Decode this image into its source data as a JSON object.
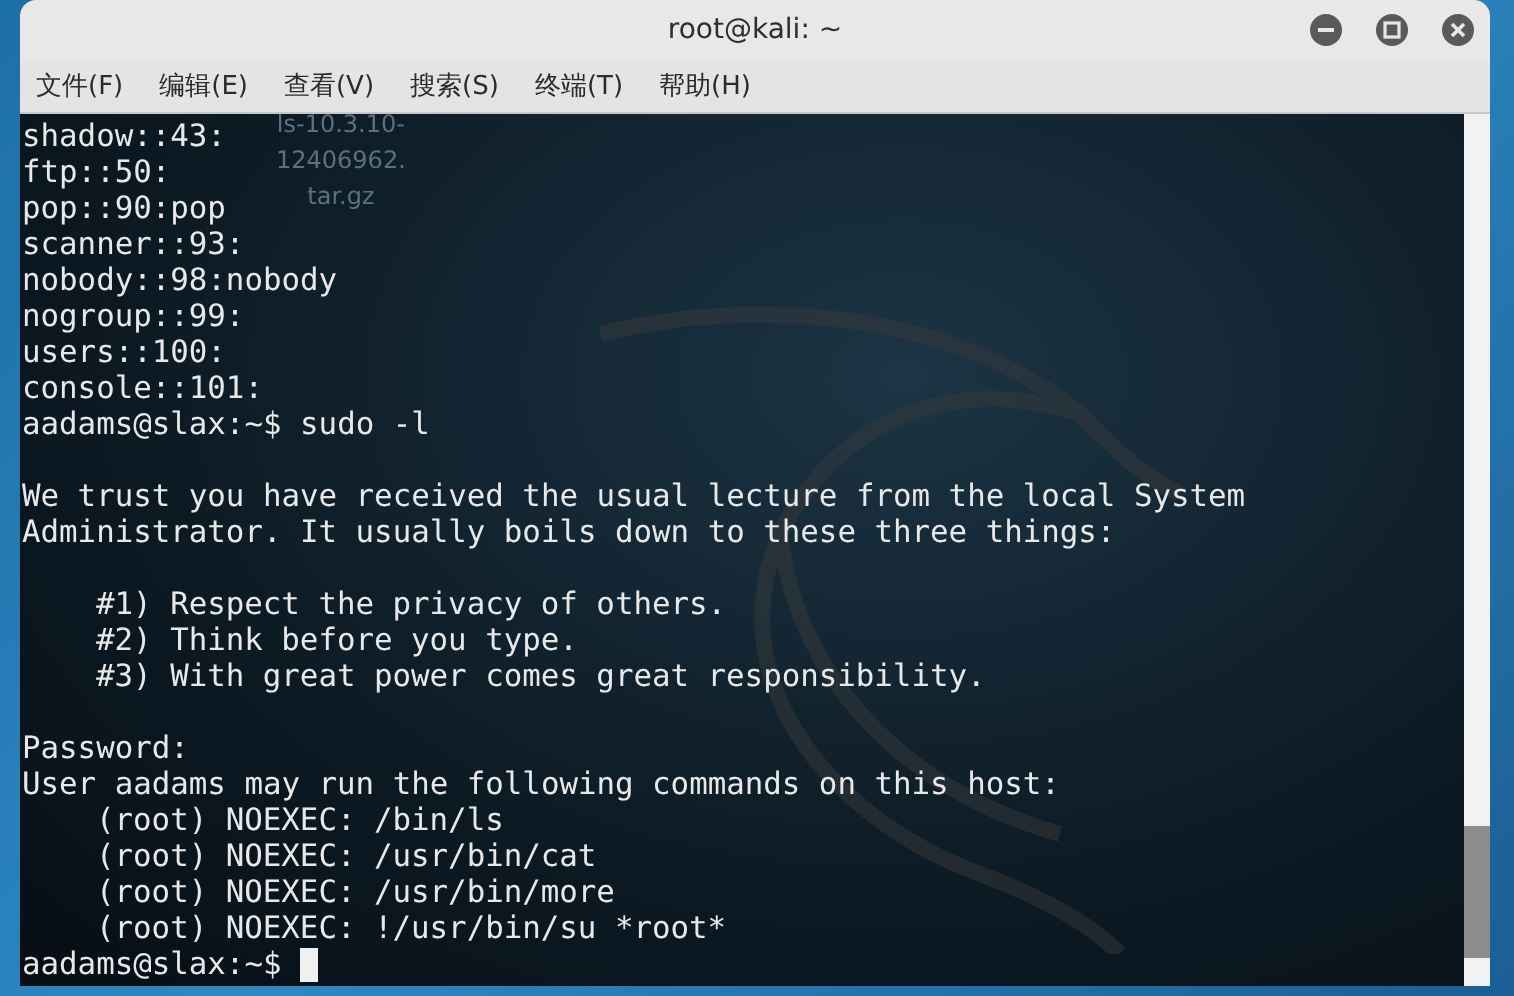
{
  "window": {
    "title": "root@kali: ~"
  },
  "menu": [
    {
      "label": "文件(F)"
    },
    {
      "label": "编辑(E)"
    },
    {
      "label": "查看(V)"
    },
    {
      "label": "搜索(S)"
    },
    {
      "label": "终端(T)"
    },
    {
      "label": "帮助(H)"
    }
  ],
  "desktop_label": [
    "ls-10.3.10-",
    "12406962.",
    "tar.gz"
  ],
  "terminal": {
    "lines": [
      {
        "kind": "output",
        "text": "shadow::43:"
      },
      {
        "kind": "output",
        "text": "ftp::50:"
      },
      {
        "kind": "output",
        "text": "pop::90:pop"
      },
      {
        "kind": "output",
        "text": "scanner::93:"
      },
      {
        "kind": "output",
        "text": "nobody::98:nobody"
      },
      {
        "kind": "output",
        "text": "nogroup::99:"
      },
      {
        "kind": "output",
        "text": "users::100:"
      },
      {
        "kind": "output",
        "text": "console::101:"
      },
      {
        "kind": "prompt",
        "prompt": "aadams@slax:~$",
        "command": "sudo -l",
        "cursor": false
      },
      {
        "kind": "blank"
      },
      {
        "kind": "output",
        "text": "We trust you have received the usual lecture from the local System"
      },
      {
        "kind": "output",
        "text": "Administrator. It usually boils down to these three things:"
      },
      {
        "kind": "blank"
      },
      {
        "kind": "indented",
        "text": "#1) Respect the privacy of others."
      },
      {
        "kind": "indented",
        "text": "#2) Think before you type."
      },
      {
        "kind": "indented",
        "text": "#3) With great power comes great responsibility."
      },
      {
        "kind": "blank"
      },
      {
        "kind": "output",
        "text": "Password:"
      },
      {
        "kind": "output",
        "text": "User aadams may run the following commands on this host:"
      },
      {
        "kind": "indented",
        "text": "(root) NOEXEC: /bin/ls"
      },
      {
        "kind": "indented",
        "text": "(root) NOEXEC: /usr/bin/cat"
      },
      {
        "kind": "indented",
        "text": "(root) NOEXEC: /usr/bin/more"
      },
      {
        "kind": "indented",
        "text": "(root) NOEXEC: !/usr/bin/su *root*"
      },
      {
        "kind": "prompt",
        "prompt": "aadams@slax:~$",
        "cursor": true
      }
    ]
  }
}
